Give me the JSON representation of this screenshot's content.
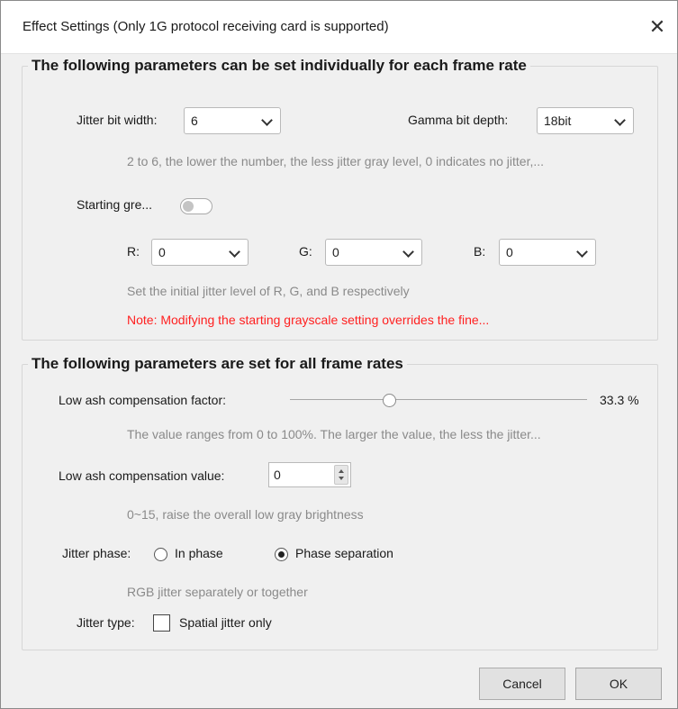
{
  "dialog": {
    "title": "Effect Settings (Only 1G protocol receiving card is supported)",
    "close_glyph": "✕"
  },
  "group1": {
    "legend": "The following parameters can be set individually for each frame rate",
    "jitter_bit_width_label": "Jitter bit width:",
    "jitter_bit_width_value": "6",
    "gamma_bit_depth_label": "Gamma bit depth:",
    "gamma_bit_depth_value": "18bit",
    "jitter_hint": "2 to 6, the lower the number, the less jitter gray level, 0 indicates no jitter,...",
    "starting_gray_label": "Starting gre...",
    "starting_gray_on": false,
    "r_label": "R:",
    "r_value": "0",
    "g_label": "G:",
    "g_value": "0",
    "b_label": "B:",
    "b_value": "0",
    "rgb_hint": "Set the initial jitter level of R, G, and B respectively",
    "note": "Note: Modifying the starting grayscale setting overrides the fine..."
  },
  "group2": {
    "legend": "The following parameters are set for all frame rates",
    "low_ash_factor_label": "Low ash compensation factor:",
    "low_ash_factor_value": 33.3,
    "low_ash_factor_text": "33.3 %",
    "low_ash_factor_hint": "The value ranges from 0 to 100%. The larger the value, the less the jitter...",
    "low_ash_value_label": "Low ash compensation value:",
    "low_ash_value": "0",
    "low_ash_value_hint": "0~15, raise the overall low gray brightness",
    "jitter_phase_label": "Jitter phase:",
    "phase_options": [
      "In phase",
      "Phase separation"
    ],
    "phase_selected": "Phase separation",
    "phase_hint": "RGB jitter separately or together",
    "jitter_type_label": "Jitter type:",
    "spatial_only_label": "Spatial jitter only",
    "spatial_only_checked": false
  },
  "footer": {
    "cancel_label": "Cancel",
    "ok_label": "OK"
  },
  "colors": {
    "note_red": "#ff2020",
    "hint_gray": "#8a8a8a",
    "background": "#f0f0f0"
  }
}
